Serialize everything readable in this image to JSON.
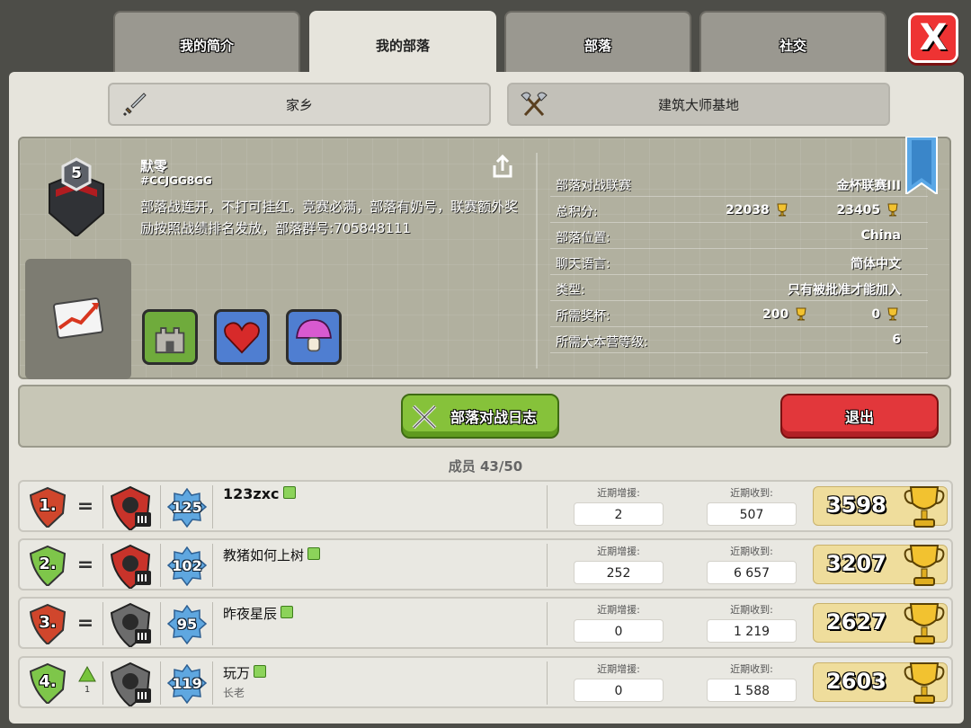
{
  "tabs": [
    {
      "label": "我的简介"
    },
    {
      "label": "我的部落"
    },
    {
      "label": "部落"
    },
    {
      "label": "社交"
    }
  ],
  "close_label": "X",
  "subtabs": {
    "home": "家乡",
    "builder": "建筑大师基地"
  },
  "clan": {
    "level": "5",
    "name": "默零",
    "tag": "#CCJGG8GG",
    "description": "部落战连开，不打可挂红。竞赛必满，部落有奶号，联赛额外奖励按照战绩排名发放，部落群号:705848111",
    "info": [
      {
        "label": "部落对战联赛",
        "value": "金杯联赛III"
      },
      {
        "label": "总积分:",
        "value_a": "22038",
        "value_b": "23405"
      },
      {
        "label": "部落位置:",
        "value": "China"
      },
      {
        "label": "聊天语言:",
        "value": "简体中文"
      },
      {
        "label": "类型:",
        "value": "只有被批准才能加入"
      },
      {
        "label": "所需奖杯:",
        "value_a": "200",
        "value_b": "0"
      },
      {
        "label": "所需大本营等级:",
        "value": "6"
      }
    ]
  },
  "buttons": {
    "war_log": "部落对战日志",
    "leave": "退出"
  },
  "members_title": "成员 43/50",
  "donation_labels": {
    "given": "近期增援:",
    "received": "近期收到:"
  },
  "members": [
    {
      "rank": "1.",
      "change": "=",
      "level": "125",
      "name": "123zxc",
      "role": "",
      "given": "2",
      "received": "507",
      "trophies": "3598"
    },
    {
      "rank": "2.",
      "change": "=",
      "level": "102",
      "name": "教猪如何上树",
      "role": "",
      "given": "252",
      "received": "6 657",
      "trophies": "3207"
    },
    {
      "rank": "3.",
      "change": "=",
      "level": "95",
      "name": "昨夜星辰",
      "role": "",
      "given": "0",
      "received": "1 219",
      "trophies": "2627"
    },
    {
      "rank": "4.",
      "change": "1",
      "level": "119",
      "name": "玩万",
      "role": "长老",
      "given": "0",
      "received": "1 588",
      "trophies": "2603"
    }
  ],
  "colors": {
    "accent_green": "#86c23a",
    "danger_red": "#e2373b",
    "trophy_gold": "#efdd9c"
  }
}
